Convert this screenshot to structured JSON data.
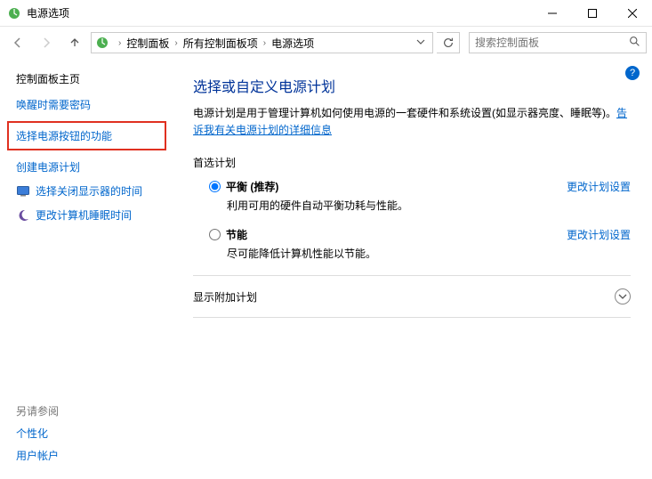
{
  "window": {
    "title": "电源选项"
  },
  "breadcrumb": {
    "items": [
      "控制面板",
      "所有控制面板项",
      "电源选项"
    ]
  },
  "search": {
    "placeholder": "搜索控制面板"
  },
  "sidebar": {
    "home": "控制面板主页",
    "links": [
      {
        "label": "唤醒时需要密码"
      },
      {
        "label": "选择电源按钮的功能",
        "highlighted": true
      },
      {
        "label": "创建电源计划"
      },
      {
        "label": "选择关闭显示器的时间",
        "icon": "monitor"
      },
      {
        "label": "更改计算机睡眠时间",
        "icon": "moon"
      }
    ],
    "see_also_header": "另请参阅",
    "see_also": [
      "个性化",
      "用户帐户"
    ]
  },
  "main": {
    "heading": "选择或自定义电源计划",
    "description_prefix": "电源计划是用于管理计算机如何使用电源的一套硬件和系统设置(如显示器亮度、睡眠等)。",
    "description_link": "告诉我有关电源计划的详细信息",
    "preferred_heading": "首选计划",
    "plans": [
      {
        "name": "平衡 (推荐)",
        "desc": "利用可用的硬件自动平衡功耗与性能。",
        "selected": true,
        "change_label": "更改计划设置"
      },
      {
        "name": "节能",
        "desc": "尽可能降低计算机性能以节能。",
        "selected": false,
        "change_label": "更改计划设置"
      }
    ],
    "additional_heading": "显示附加计划"
  },
  "help_icon_char": "?"
}
